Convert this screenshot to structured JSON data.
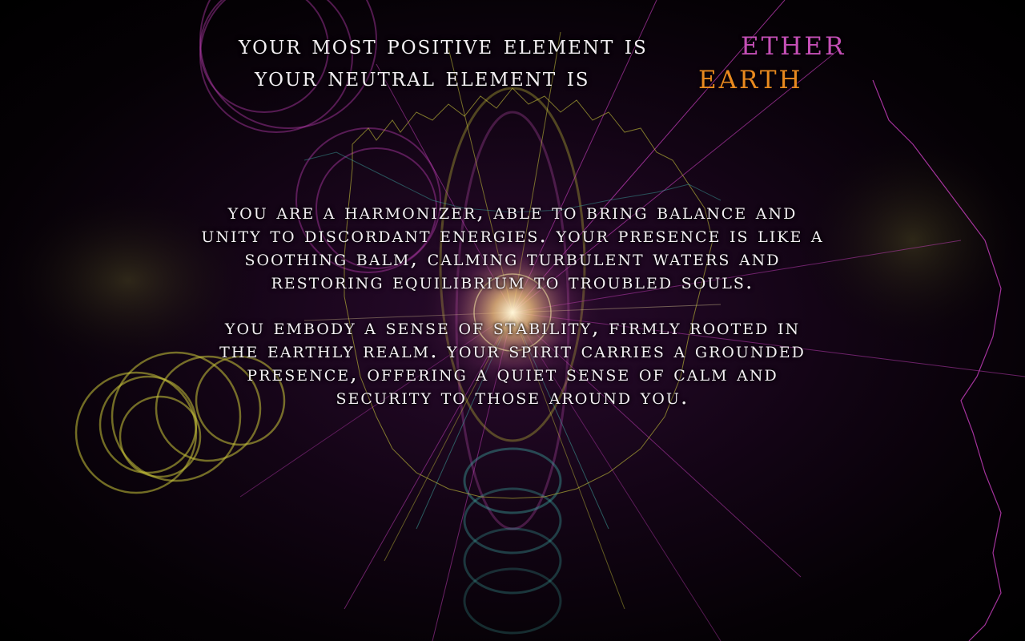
{
  "result": {
    "positive_label": "Your most positive element is",
    "positive_element": "Ether",
    "neutral_label": "Your neutral element is",
    "neutral_element": "Earth"
  },
  "description": {
    "paragraph_1": [
      "You are a harmonizer, able to bring balance and",
      "unity to discordant energies. Your presence is like a",
      "soothing balm, calming turbulent waters and",
      "restoring equilibrium to troubled souls."
    ],
    "paragraph_2": [
      "You embody a sense of stability, firmly rooted in",
      "the earthly realm. Your spirit carries a grounded",
      "presence, offering a quiet sense of calm and",
      "security to those around you."
    ]
  },
  "colors": {
    "ether": "#c54fb6",
    "earth": "#e8891f",
    "text": "#f4f0f4",
    "magenta_line": "#c93fbf",
    "yellow_glow": "#c8c43a",
    "teal_glow": "#3fb0a8"
  }
}
